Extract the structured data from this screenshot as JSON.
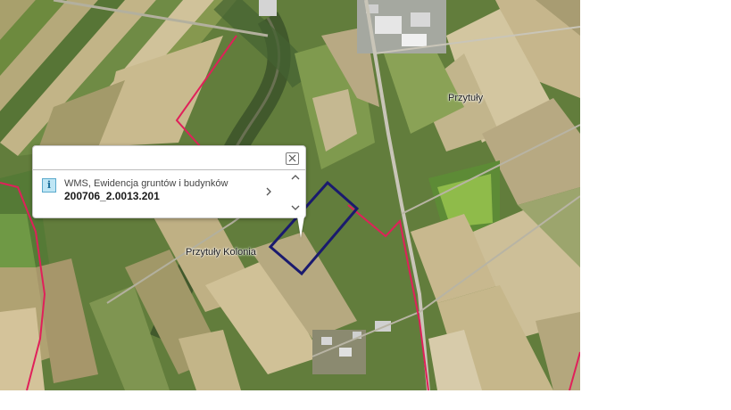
{
  "map": {
    "place_labels": {
      "przytuly": "Przytuły",
      "przytuly_kolonia": "Przytuły Kolonia"
    },
    "colors": {
      "boundary_line": "#e0205a",
      "parcel_outline": "#1a1a6e",
      "road": "#c9c5b8"
    }
  },
  "popup": {
    "layer_name": "WMS, Ewidencja gruntów i budynków",
    "feature_id": "200706_2.0013.201",
    "icons": {
      "info": "info-icon",
      "close": "close-icon",
      "next": "chevron-right-icon",
      "scroll_up": "chevron-up-icon",
      "scroll_down": "chevron-down-icon"
    },
    "info_glyph": "i"
  }
}
